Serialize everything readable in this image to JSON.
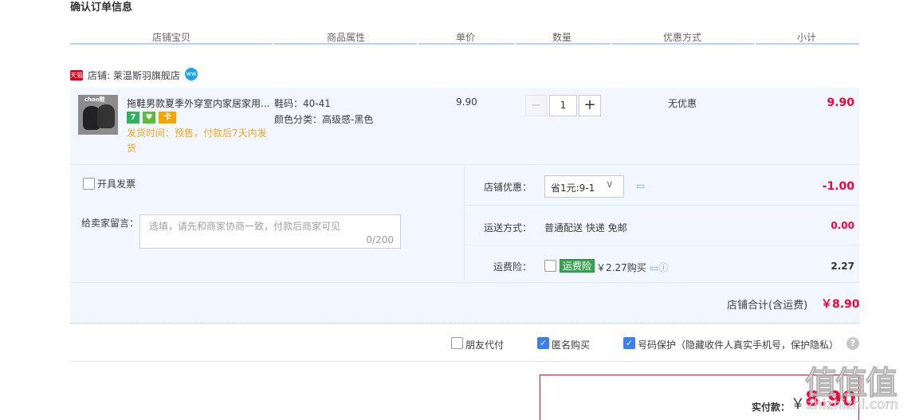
{
  "page": {
    "title": "确认订单信息"
  },
  "columns": [
    "店铺宝贝",
    "商品属性",
    "单价",
    "数量",
    "优惠方式",
    "小计"
  ],
  "shop": {
    "tag": "天猫",
    "name": "店铺: 莱温斯羽旗舰店",
    "wangwang_badge": "ww"
  },
  "item": {
    "image_brand": "chao鞋",
    "title": "拖鞋男款夏季外穿室内家居家用...",
    "badges": [
      "7",
      "♥",
      "卡"
    ],
    "delivery": "发货时间：预售，付款后7天内发货",
    "attr_size": "鞋码：40-41",
    "attr_color": "颜色分类：高级感-黑色",
    "unit_price": "9.90",
    "qty_minus": "−",
    "quantity": "1",
    "qty_plus": "+",
    "discount": "无优惠",
    "subtotal": "9.90"
  },
  "options": {
    "invoice_label": "开具发票",
    "memo_label": "给卖家留言：",
    "memo_placeholder": "选填，请先和商家协商一致，付款后商家可见",
    "memo_count": "0/200",
    "shop_discount_label": "店铺优惠：",
    "shop_discount_value": "省1元:9-1",
    "shop_discount_amount": "-1.00",
    "shipping_label": "运送方式：",
    "shipping_value": "普通配送 快递 免邮",
    "shipping_amount": "0.00",
    "insurance_label": "运费险：",
    "insurance_tag": "运费险",
    "insurance_price": "￥2.27购买",
    "insurance_amount": "2.27"
  },
  "shop_total": {
    "label": "店铺合计(含运费)",
    "amount": "￥8.90"
  },
  "extras": {
    "friend_pay": "朋友代付",
    "anonymous": "匿名购买",
    "number_protect": "号码保护（隐藏收件人真实手机号，保护隐私）"
  },
  "pay": {
    "label": "实付款：",
    "currency": "￥",
    "amount": "8.90"
  },
  "watermark": {
    "text": "值值值",
    "url": "zhizhizhi.com"
  },
  "colors": {
    "accent_red": "#ff0036",
    "header_line": "#b2d1ff",
    "row_bg": "#f2f7ff",
    "checkbox_blue": "#3a7ff1"
  }
}
